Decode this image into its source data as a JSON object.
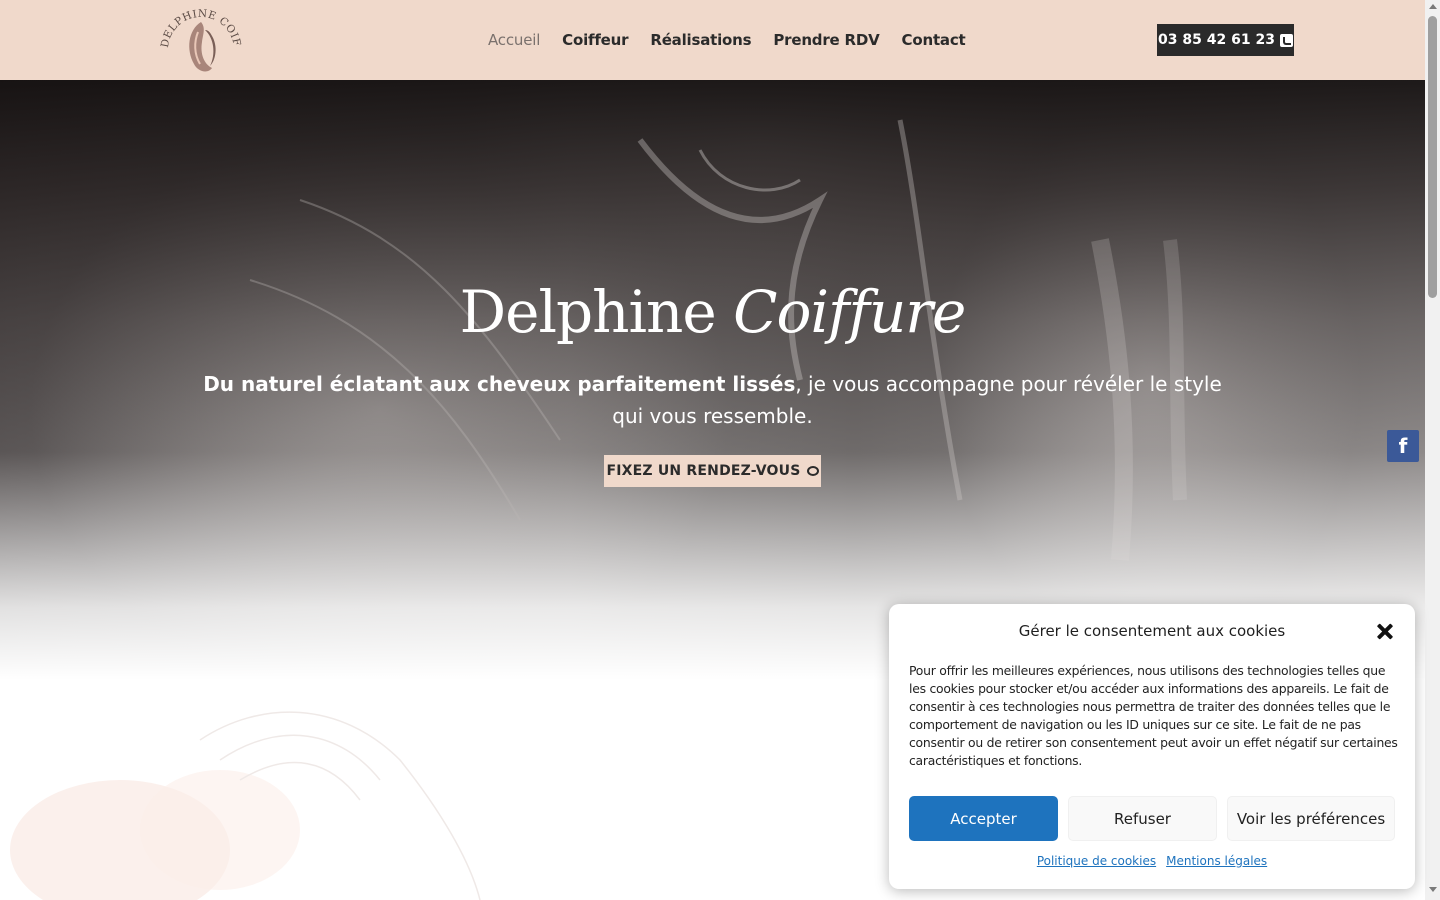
{
  "header": {
    "logo": {
      "text": "DELPHINE COIFFURE"
    },
    "nav": [
      {
        "label": "Accueil"
      },
      {
        "label": "Coiffeur"
      },
      {
        "label": "Réalisations"
      },
      {
        "label": "Prendre RDV"
      },
      {
        "label": "Contact"
      }
    ],
    "phone": {
      "label": "03 85 42 61 23",
      "icon": "phone-icon"
    }
  },
  "hero": {
    "title_main": "Delphine",
    "title_italic": "Coiffure",
    "subtitle_bold": "Du naturel éclatant aux cheveux parfaitement lissés",
    "subtitle_rest": ", je vous accompagne pour révéler le style qui vous ressemble.",
    "cta_label": "FIXEZ UN RENDEZ-VOUS",
    "cta_icon": "chat-bubble-icon"
  },
  "social": {
    "facebook_label": "f"
  },
  "cookie": {
    "title": "Gérer le consentement aux cookies",
    "text": "Pour offrir les meilleures expériences, nous utilisons des technologies telles que les cookies pour stocker et/ou accéder aux informations des appareils. Le fait de consentir à ces technologies nous permettra de traiter des données telles que le comportement de navigation ou les ID uniques sur ce site. Le fait de ne pas consentir ou de retirer son consentement peut avoir un effet négatif sur certaines caractéristiques et fonctions.",
    "accept": "Accepter",
    "refuse": "Refuser",
    "preferences": "Voir les préférences",
    "links": [
      {
        "label": "Politique de cookies"
      },
      {
        "label": "Mentions légales"
      }
    ]
  },
  "colors": {
    "header_bg": "#f0d9cb",
    "phone_btn_bg": "#2a2a2a",
    "accept_btn": "#1e73be",
    "facebook": "#3b5998"
  }
}
